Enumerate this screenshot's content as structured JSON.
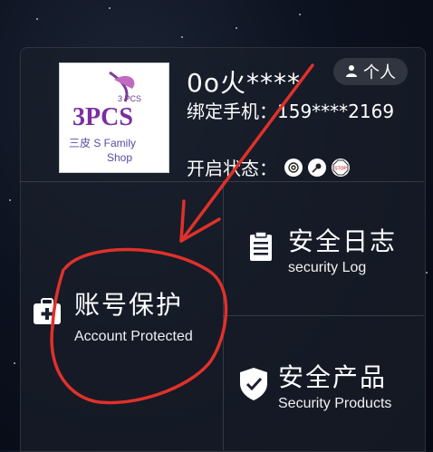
{
  "user": {
    "name": "0o火****",
    "phone_label": "绑定手机：159****2169",
    "status_label": "开启状态：",
    "status_icons": [
      "fingerprint-icon",
      "satellite-icon",
      "stop-sign-icon"
    ],
    "avatar_text": {
      "top": "3 PCS",
      "mid": "3PCS",
      "brand": "三皮 S Family",
      "bottom": "Shop"
    }
  },
  "personal_button": {
    "label": "个人"
  },
  "tiles": {
    "account": {
      "title": "账号保护",
      "subtitle": "Account Protected"
    },
    "log": {
      "title": "安全日志",
      "subtitle": "security Log"
    },
    "products": {
      "title": "安全产品",
      "subtitle": "Security Products"
    }
  },
  "annotation_color": "#e0312b"
}
